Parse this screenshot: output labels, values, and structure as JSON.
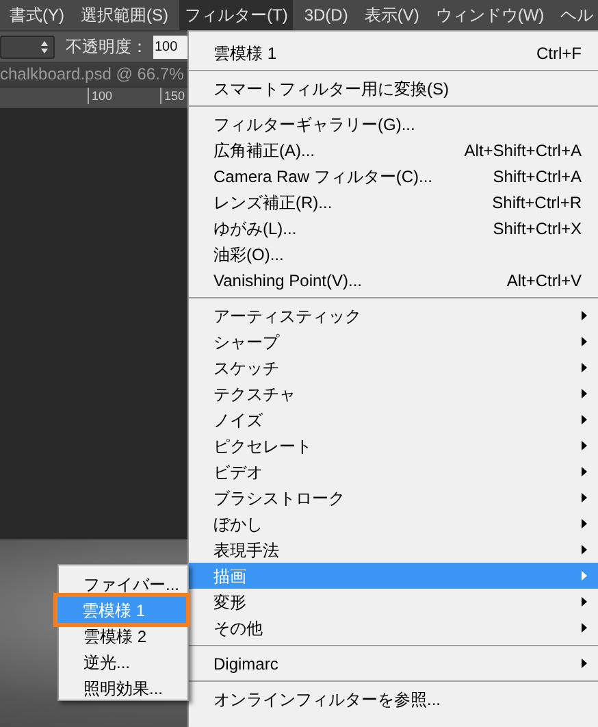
{
  "menu_bar": [
    {
      "label": "書式(Y)",
      "selected": false
    },
    {
      "label": "選択範囲(S)",
      "selected": false
    },
    {
      "label": "フィルター(T)",
      "selected": true
    },
    {
      "label": "3D(D)",
      "selected": false
    },
    {
      "label": "表示(V)",
      "selected": false
    },
    {
      "label": "ウィンドウ(W)",
      "selected": false
    },
    {
      "label": "ヘル",
      "selected": false
    }
  ],
  "options_bar": {
    "opacity_label": "不透明度：",
    "opacity_value": "100"
  },
  "document_tab": {
    "title": "chalkboard.psd @ 66.7%"
  },
  "ruler": {
    "labels": [
      "100",
      "150"
    ]
  },
  "filter_menu": [
    {
      "kind": "item",
      "label": "雲模様 1",
      "shortcut": "Ctrl+F",
      "selected": false
    },
    {
      "kind": "separator"
    },
    {
      "kind": "item",
      "label": "スマートフィルター用に変換(S)",
      "selected": false
    },
    {
      "kind": "separator"
    },
    {
      "kind": "item",
      "label": "フィルターギャラリー(G)...",
      "selected": false
    },
    {
      "kind": "item",
      "label": "広角補正(A)...",
      "shortcut": "Alt+Shift+Ctrl+A",
      "selected": false
    },
    {
      "kind": "item",
      "label": "Camera Raw フィルター(C)...",
      "shortcut": "Shift+Ctrl+A",
      "selected": false
    },
    {
      "kind": "item",
      "label": "レンズ補正(R)...",
      "shortcut": "Shift+Ctrl+R",
      "selected": false
    },
    {
      "kind": "item",
      "label": "ゆがみ(L)...",
      "shortcut": "Shift+Ctrl+X",
      "selected": false
    },
    {
      "kind": "item",
      "label": "油彩(O)...",
      "selected": false
    },
    {
      "kind": "item",
      "label": "Vanishing Point(V)...",
      "shortcut": "Alt+Ctrl+V",
      "selected": false
    },
    {
      "kind": "separator"
    },
    {
      "kind": "submenu",
      "label": "アーティスティック",
      "selected": false
    },
    {
      "kind": "submenu",
      "label": "シャープ",
      "selected": false
    },
    {
      "kind": "submenu",
      "label": "スケッチ",
      "selected": false
    },
    {
      "kind": "submenu",
      "label": "テクスチャ",
      "selected": false
    },
    {
      "kind": "submenu",
      "label": "ノイズ",
      "selected": false
    },
    {
      "kind": "submenu",
      "label": "ピクセレート",
      "selected": false
    },
    {
      "kind": "submenu",
      "label": "ビデオ",
      "selected": false
    },
    {
      "kind": "submenu",
      "label": "ブラシストローク",
      "selected": false
    },
    {
      "kind": "submenu",
      "label": "ぼかし",
      "selected": false
    },
    {
      "kind": "submenu",
      "label": "表現手法",
      "selected": false
    },
    {
      "kind": "submenu",
      "label": "描画",
      "selected": true
    },
    {
      "kind": "submenu",
      "label": "変形",
      "selected": false
    },
    {
      "kind": "submenu",
      "label": "その他",
      "selected": false
    },
    {
      "kind": "separator"
    },
    {
      "kind": "submenu",
      "label": "Digimarc",
      "selected": false
    },
    {
      "kind": "separator"
    },
    {
      "kind": "item",
      "label": "オンラインフィルターを参照...",
      "selected": false
    }
  ],
  "render_submenu": [
    {
      "label": "ファイバー...",
      "selected": false
    },
    {
      "label": "雲模様 1",
      "selected": true
    },
    {
      "label": "雲模様 2",
      "selected": false
    },
    {
      "label": "逆光...",
      "selected": false
    },
    {
      "label": "照明効果...",
      "selected": false
    }
  ]
}
